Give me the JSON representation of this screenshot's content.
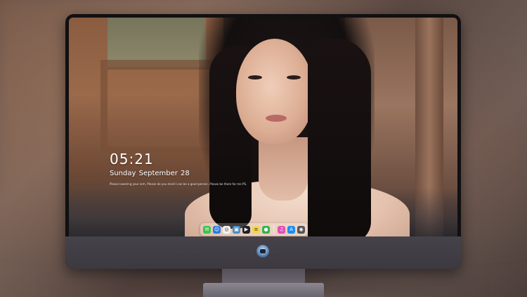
{
  "lockscreen": {
    "time": "05:21",
    "date": "Sunday September  28",
    "quote": "Please lowering your arm, Please do you mind I can be a good person, Please be there for me PS."
  },
  "dock": {
    "items": [
      {
        "name": "messages-icon",
        "glyph": "✉",
        "color": "#3ec14a"
      },
      {
        "name": "finder-icon",
        "glyph": "☺",
        "color": "#2a7de1"
      },
      {
        "name": "safari-icon",
        "glyph": "◎",
        "color": "#f2f2f2"
      },
      {
        "name": "preview-icon",
        "glyph": "▣",
        "color": "#4a90c8"
      },
      {
        "name": "finalcut-icon",
        "glyph": "▶",
        "color": "#222222"
      },
      {
        "name": "notes-icon",
        "glyph": "≡",
        "color": "#f5d547"
      },
      {
        "name": "facetime-icon",
        "glyph": "●",
        "color": "#35b24a"
      },
      {
        "name": "itunes-icon",
        "glyph": "♫",
        "color": "#e34eb6"
      },
      {
        "name": "appstore-icon",
        "glyph": "A",
        "color": "#1e8ef0"
      },
      {
        "name": "camera-icon",
        "glyph": "◉",
        "color": "#555555"
      }
    ]
  }
}
